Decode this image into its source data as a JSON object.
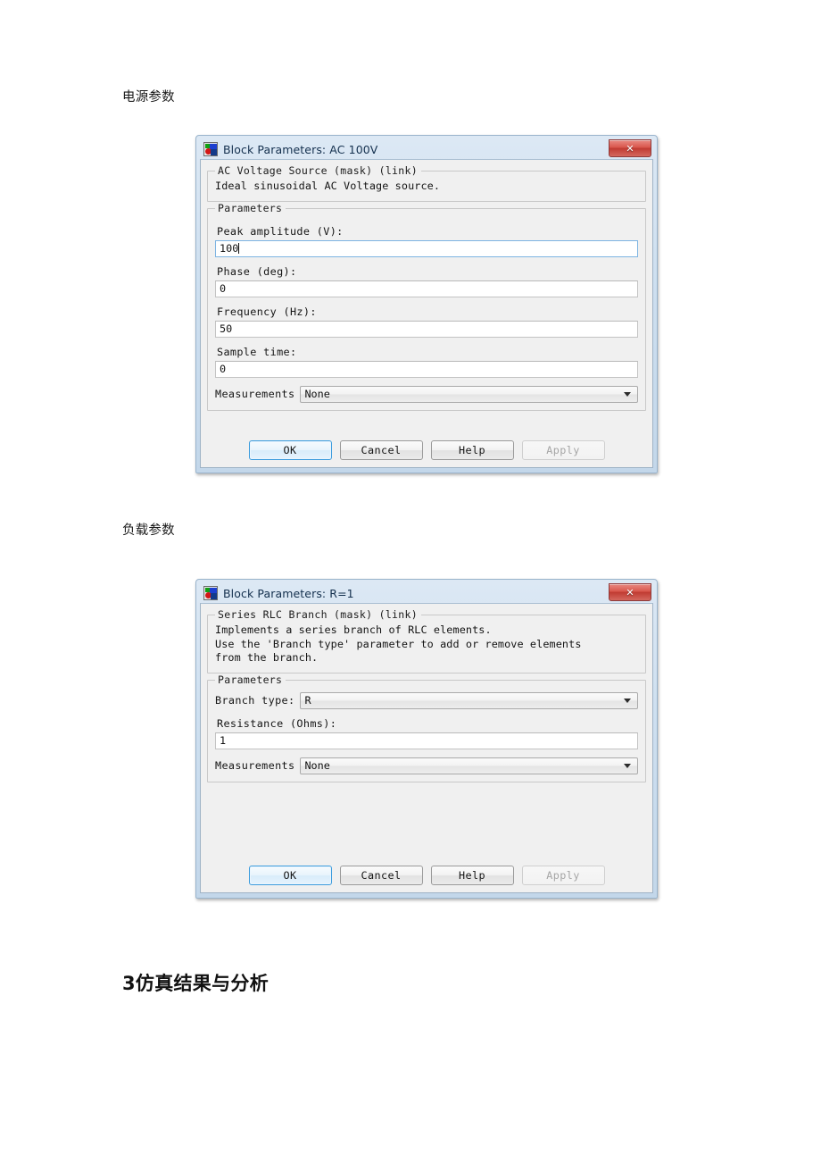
{
  "document": {
    "label_source": "电源参数",
    "label_load": "负载参数",
    "heading": "3仿真结果与分析"
  },
  "dialog_ac": {
    "icon": "simulink-block-icon",
    "title": "Block Parameters: AC 100V",
    "close_glyph": "✕",
    "mask_group_legend": "AC Voltage Source (mask) (link)",
    "description": "Ideal sinusoidal AC Voltage source.",
    "parameters_legend": "Parameters",
    "fields": [
      {
        "label": "Peak amplitude (V):",
        "value": "100",
        "focused": true
      },
      {
        "label": "Phase (deg):",
        "value": "0",
        "focused": false
      },
      {
        "label": "Frequency (Hz):",
        "value": "50",
        "focused": false
      },
      {
        "label": "Sample time:",
        "value": "0",
        "focused": false
      }
    ],
    "measurements": {
      "label": "Measurements",
      "value": "None"
    },
    "buttons": [
      {
        "label": "OK",
        "state": "default"
      },
      {
        "label": "Cancel",
        "state": "normal"
      },
      {
        "label": "Help",
        "state": "normal"
      },
      {
        "label": "Apply",
        "state": "disabled"
      }
    ]
  },
  "dialog_rlc": {
    "icon": "simulink-block-icon",
    "title": "Block Parameters: R=1",
    "close_glyph": "✕",
    "mask_group_legend": "Series RLC Branch (mask) (link)",
    "description_lines": [
      "Implements a series branch of RLC elements.",
      "Use the 'Branch type' parameter to add or remove elements",
      "from the branch."
    ],
    "parameters_legend": "Parameters",
    "branch_type": {
      "label": "Branch type:",
      "value": "R"
    },
    "resistance": {
      "label": "Resistance (Ohms):",
      "value": "1"
    },
    "measurements": {
      "label": "Measurements",
      "value": "None"
    },
    "buttons": [
      {
        "label": "OK",
        "state": "default"
      },
      {
        "label": "Cancel",
        "state": "normal"
      },
      {
        "label": "Help",
        "state": "normal"
      },
      {
        "label": "Apply",
        "state": "disabled"
      }
    ]
  },
  "colors": {
    "titlebar_text": "#14304e",
    "close_button": "#c03a31",
    "focus_blue": "#3c9cdd",
    "window_frame": "#c3d7ea"
  }
}
